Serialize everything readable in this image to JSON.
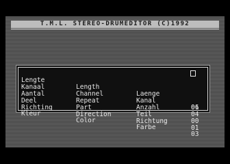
{
  "title": "T.M.L. STEREO-DRUMEDITOR (C)1992",
  "rows": [
    {
      "nl": "Lengte",
      "en": "Length",
      "de": "Laenge",
      "value": "06"
    },
    {
      "nl": "Kanaal",
      "en": "Channel",
      "de": "Kanal",
      "value": "01"
    },
    {
      "nl": "Aantal",
      "en": "Repeat",
      "de": "Anzahl",
      "value": "04"
    },
    {
      "nl": "Deel",
      "en": "Part",
      "de": "Teil",
      "value": "00"
    },
    {
      "nl": "Richting",
      "en": "Direction",
      "de": "Richtung",
      "value": "01"
    },
    {
      "nl": "Kleur",
      "en": "Color",
      "de": "Farbe",
      "value": "03"
    }
  ]
}
